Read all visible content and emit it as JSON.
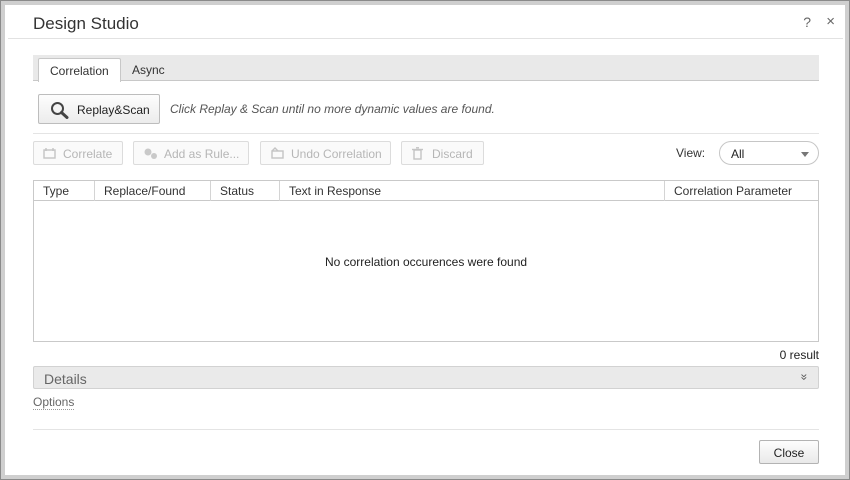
{
  "window": {
    "title": "Design Studio",
    "help_glyph": "?",
    "close_glyph": "×"
  },
  "tabs": [
    {
      "label": "Correlation",
      "active": true
    },
    {
      "label": "Async",
      "active": false
    }
  ],
  "scan": {
    "button_label": "Replay&Scan",
    "icon": "search-icon",
    "hint": "Click Replay & Scan until no more dynamic values are found."
  },
  "toolbar": {
    "buttons": [
      {
        "label": "Correlate",
        "icon": "correlate-icon",
        "enabled": false
      },
      {
        "label": "Add as Rule...",
        "icon": "rule-icon",
        "enabled": false
      },
      {
        "label": "Undo Correlation",
        "icon": "undo-correlation-icon",
        "enabled": false
      },
      {
        "label": "Discard",
        "icon": "trash-icon",
        "enabled": false
      }
    ],
    "view_label": "View:",
    "view_value": "All"
  },
  "grid": {
    "columns": [
      "Type",
      "Replace/Found",
      "Status",
      "Text in Response",
      "Correlation Parameter"
    ],
    "empty_message": "No correlation occurences were found",
    "result_count": "0 result"
  },
  "details": {
    "label": "Details",
    "chevron": "»"
  },
  "options_label": "Options",
  "footer": {
    "close_label": "Close"
  },
  "colors": {
    "disabled_text": "#b6b6b6",
    "panel_bg": "#eaeaea"
  }
}
